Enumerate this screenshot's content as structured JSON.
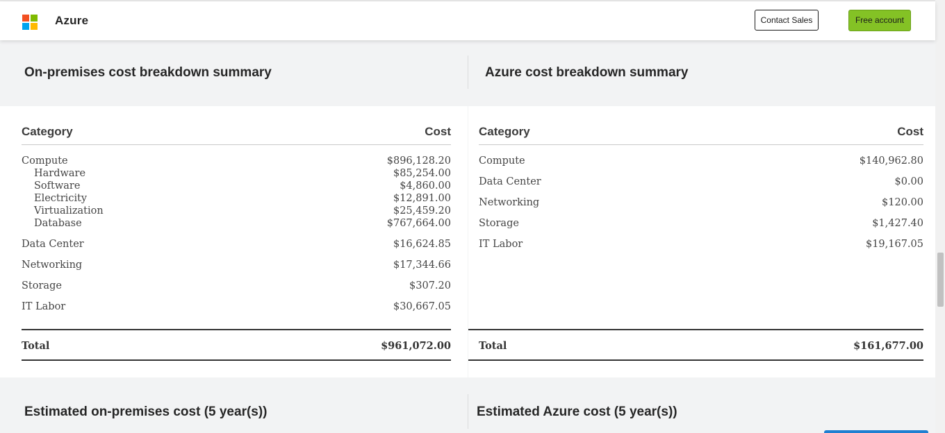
{
  "header": {
    "brand": "Azure",
    "logo_colors": [
      "#f25022",
      "#7fba00",
      "#00a4ef",
      "#ffb900"
    ],
    "contact_sales_label": "Contact Sales",
    "free_account_label": "Free account",
    "accent_color": "#84c225"
  },
  "onprem": {
    "title": "On-premises cost breakdown summary",
    "col_category": "Category",
    "col_cost": "Cost",
    "rows": [
      {
        "label": "Compute",
        "cost": "$896,128.20"
      },
      {
        "label": "Hardware",
        "cost": "$85,254.00"
      },
      {
        "label": "Software",
        "cost": "$4,860.00"
      },
      {
        "label": "Electricity",
        "cost": "$12,891.00"
      },
      {
        "label": "Virtualization",
        "cost": "$25,459.20"
      },
      {
        "label": "Database",
        "cost": "$767,664.00"
      },
      {
        "label": "Data Center",
        "cost": "$16,624.85"
      },
      {
        "label": "Networking",
        "cost": "$17,344.66"
      },
      {
        "label": "Storage",
        "cost": "$307.20"
      },
      {
        "label": "IT Labor",
        "cost": "$30,667.05"
      }
    ],
    "total_label": "Total",
    "total_value": "$961,072.00"
  },
  "azure": {
    "title": "Azure cost breakdown summary",
    "col_category": "Category",
    "col_cost": "Cost",
    "rows": [
      {
        "label": "Compute",
        "cost": "$140,962.80"
      },
      {
        "label": "Data Center",
        "cost": "$0.00"
      },
      {
        "label": "Networking",
        "cost": "$120.00"
      },
      {
        "label": "Storage",
        "cost": "$1,427.40"
      },
      {
        "label": "IT Labor",
        "cost": "$19,167.05"
      }
    ],
    "total_label": "Total",
    "total_value": "$161,677.00"
  },
  "estimates": {
    "onprem_title": "Estimated on-premises cost (5 year(s))",
    "azure_title": "Estimated Azure cost (5 year(s))"
  }
}
